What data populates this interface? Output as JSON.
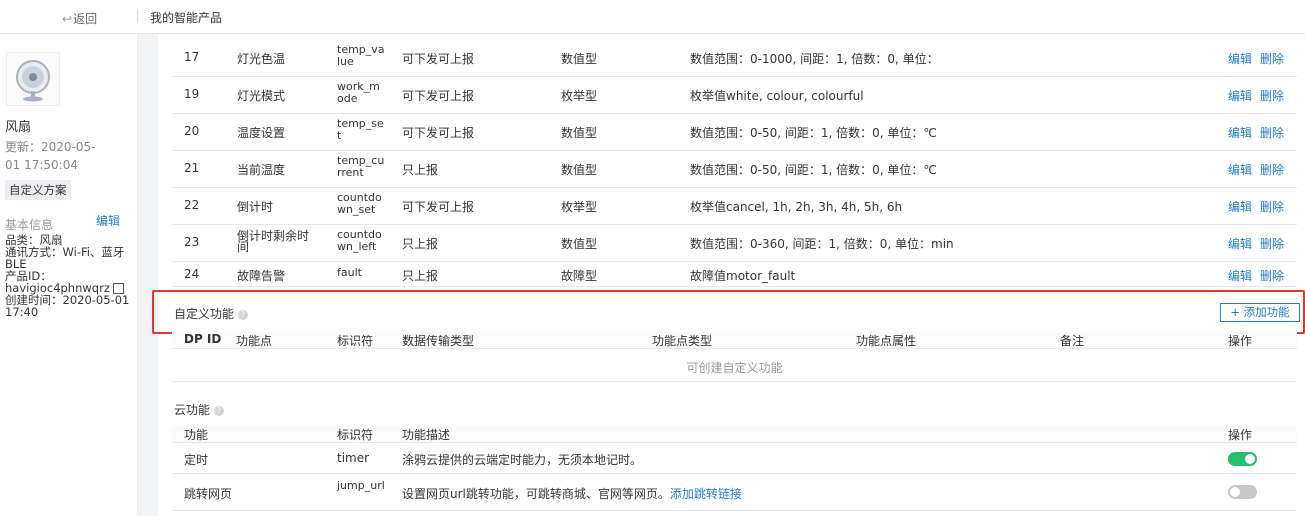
{
  "topbar": {
    "back_label": "返回",
    "back_icon": "undo-arrow-icon",
    "breadcrumb": "我的智能产品"
  },
  "sidebar": {
    "product_name": "风扇",
    "updated": "更新：2020-05-01 17:50:04",
    "scheme_tag": "自定义方案",
    "basic_info_label": "基本信息",
    "edit_label": "编辑",
    "category": "品类：风扇",
    "comm_mode": "通讯方式：Wi-Fi、蓝牙BLE",
    "product_id_label": "产品ID：",
    "product_id": "havigioc4phnwqrz",
    "created": "创建时间：2020-05-01 17:40"
  },
  "dp_rows": [
    {
      "id": "17",
      "name": "灯光色温",
      "code": "temp_value",
      "transfer": "可下发可上报",
      "type": "数值型",
      "attr": "数值范围：0-1000, 间距：1, 倍数：0, 单位：",
      "edit": "编辑",
      "del": "删除"
    },
    {
      "id": "19",
      "name": "灯光模式",
      "code": "work_mode",
      "transfer": "可下发可上报",
      "type": "枚举型",
      "attr": "枚举值white, colour, colourful",
      "edit": "编辑",
      "del": "删除"
    },
    {
      "id": "20",
      "name": "温度设置",
      "code": "temp_set",
      "transfer": "可下发可上报",
      "type": "数值型",
      "attr": "数值范围：0-50, 间距：1, 倍数：0, 单位：℃",
      "edit": "编辑",
      "del": "删除"
    },
    {
      "id": "21",
      "name": "当前温度",
      "code": "temp_current",
      "transfer": "只上报",
      "type": "数值型",
      "attr": "数值范围：0-50, 间距：1, 倍数：0, 单位：℃",
      "edit": "编辑",
      "del": "删除"
    },
    {
      "id": "22",
      "name": "倒计时",
      "code": "countdown_set",
      "transfer": "可下发可上报",
      "type": "枚举型",
      "attr": "枚举值cancel, 1h, 2h, 3h, 4h, 5h, 6h",
      "edit": "编辑",
      "del": "删除"
    },
    {
      "id": "23",
      "name": "倒计时剩余时间",
      "code": "countdown_left",
      "transfer": "只上报",
      "type": "数值型",
      "attr": "数值范围：0-360, 间距：1, 倍数：0, 单位：min",
      "edit": "编辑",
      "del": "删除"
    },
    {
      "id": "24",
      "name": "故障告警",
      "code": "fault",
      "transfer": "只上报",
      "type": "故障型",
      "attr": "故障值motor_fault",
      "edit": "编辑",
      "del": "删除"
    }
  ],
  "custom": {
    "title": "自定义功能",
    "add_button": "+ 添加功能",
    "headers": [
      "DP ID",
      "功能点",
      "标识符",
      "数据传输类型",
      "功能点类型",
      "功能点属性",
      "备注",
      "操作"
    ],
    "empty_text": "可创建自定义功能"
  },
  "cloud": {
    "title": "云功能",
    "headers": [
      "功能",
      "标识符",
      "功能描述",
      "操作"
    ],
    "rows": [
      {
        "name": "定时",
        "code": "timer",
        "desc": "涂鸦云提供的云端定时能力，无须本地记时。",
        "link": "",
        "enabled": true
      },
      {
        "name": "跳转网页",
        "code": "jump_url",
        "desc": "设置网页url跳转功能，可跳转商城、官网等网页。",
        "link": "添加跳转链接",
        "enabled": false
      }
    ]
  },
  "colors": {
    "accent": "#1f7bd6",
    "highlight_border": "#e0392b",
    "toggle_on": "#26bf6b",
    "toggle_off": "#c8c8c8"
  }
}
